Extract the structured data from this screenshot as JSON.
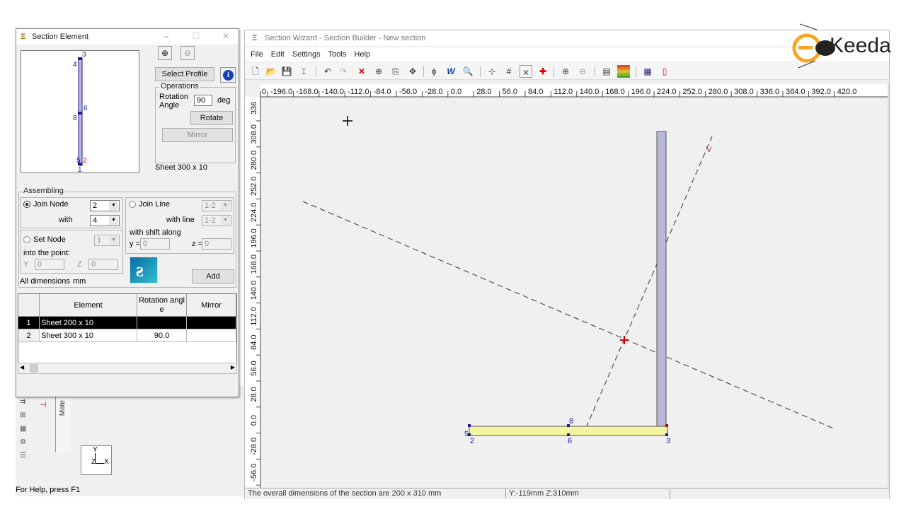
{
  "background_app": {
    "status_left": "For Help, press F1",
    "axis_labels": {
      "y": "Y",
      "z": "Z",
      "x": "X"
    },
    "side_tab": "Mate"
  },
  "section_element_dialog": {
    "title": "Section Element",
    "title_buttons": {
      "minimize": "–",
      "maximize": "☐",
      "close": "✕"
    },
    "zoom_in_icon": "magnify-plus",
    "zoom_out_icon": "magnify-minus",
    "select_profile_label": "Select Profile",
    "info_icon": "i",
    "operations": {
      "group_label": "Operations",
      "rotation_label_1": "Rotation",
      "rotation_label_2": "Angle",
      "rotation_value": "90",
      "rotation_unit": "deg",
      "rotate_button": "Rotate",
      "mirror_button": "Mirror"
    },
    "profile_caption": "Sheet 300 x 10",
    "preview_nodes": {
      "top": "3",
      "upper": "4",
      "mid_right": "6",
      "mid_left": "8",
      "bottom_a": "5",
      "bottom_b": "2",
      "bottom": "1"
    },
    "assembling": {
      "group_label": "Assembling",
      "join_node_label": "Join Node",
      "join_node_value": "2",
      "with_label": "with",
      "with_value": "4",
      "join_line_label": "Join Line",
      "join_line_value": "1-2",
      "with_line_label": "with line",
      "with_line_value": "1-2",
      "with_shift_label": "with shift along",
      "y_label": "y =",
      "y_value": "0",
      "z_label": "z =",
      "z_value": "0",
      "set_node_label": "Set Node",
      "set_node_value": "1",
      "into_point_label": "into the point:",
      "Y_label": "Y",
      "Y_value": "0",
      "Z_label": "Z",
      "Z_value": "0",
      "add_button": "Add",
      "dimensions_note_1": "All dimensions",
      "dimensions_note_2": "mm"
    },
    "table": {
      "headers": [
        "",
        "Element",
        "Rotation angl e",
        "Mirror"
      ],
      "rows": [
        {
          "index": "1",
          "element": "Sheet 200 x 10",
          "rotation": "",
          "mirror": ""
        },
        {
          "index": "2",
          "element": "Sheet 300 x 10",
          "rotation": "90.0",
          "mirror": ""
        }
      ]
    }
  },
  "section_wizard": {
    "title": "Section Wizard - Section Builder - New section",
    "menu": [
      "File",
      "Edit",
      "Settings",
      "Tools",
      "Help"
    ],
    "ruler_top": [
      "0",
      "-196.0",
      "-168.0",
      "-140.0",
      "-112.0",
      "-84.0",
      "-56.0",
      "-28.0",
      "0.0",
      "28.0",
      "56.0",
      "84.0",
      "112.0",
      "140.0",
      "168.0",
      "196.0",
      "224.0",
      "252.0",
      "280.0",
      "308.0",
      "336.0",
      "364.0",
      "392.0",
      "420.0"
    ],
    "ruler_left": [
      "336",
      "308.0",
      "280.0",
      "252.0",
      "224.0",
      "196.0",
      "168.0",
      "140.0",
      "112.0",
      "84.0",
      "56.0",
      "28.0",
      "0.0",
      "-28.0",
      "-56.0"
    ],
    "canvas_labels": {
      "axis_v": "V",
      "node_8": "8",
      "node_2": "2",
      "node_5": "5",
      "node_6": "6",
      "node_3": "3"
    },
    "status_main": "The overall dimensions of the section are 200 x 310 mm",
    "status_coords": "Y:-119mm Z:310mm"
  },
  "logo": {
    "text": "Keeda",
    "brand_color": "#f5a623"
  },
  "colors": {
    "horizontal_plate": "#f4f5a0",
    "vertical_plate": "#b8b8d8",
    "node_blue": "#1a1a9a",
    "center_red": "#cc0000"
  }
}
